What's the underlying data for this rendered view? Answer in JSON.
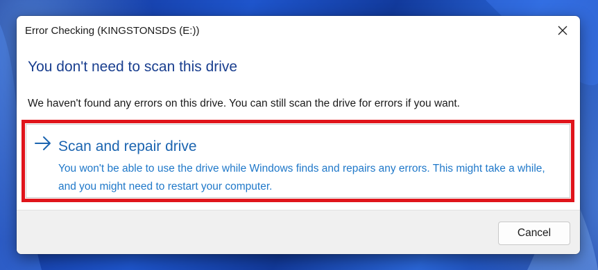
{
  "dialog": {
    "title": "Error Checking (KINGSTONSDS (E:))",
    "heading": "You don't need to scan this drive",
    "description": "We haven't found any errors on this drive. You can still scan the drive for errors if you want.",
    "option": {
      "icon": "arrow-right-icon",
      "title": "Scan and repair drive",
      "description": "You won't be able to use the drive while Windows finds and repairs any errors. This might take a while, and you might need to restart your computer."
    },
    "cancel_label": "Cancel",
    "close_icon": "close-icon"
  },
  "colors": {
    "heading": "#1a3f8f",
    "option_title": "#1b64b0",
    "option_text": "#1f78c9",
    "highlight": "#e0141b",
    "footer_bg": "#f0f0f0"
  }
}
